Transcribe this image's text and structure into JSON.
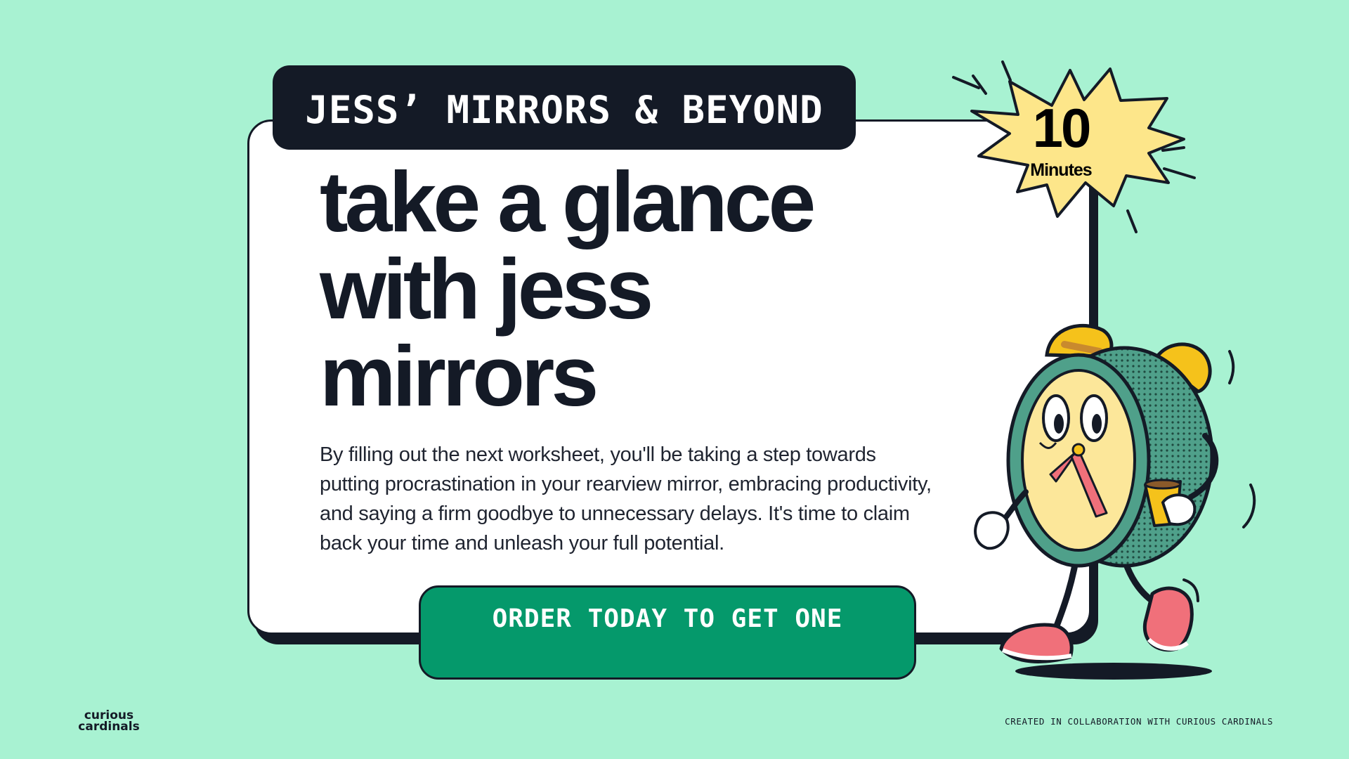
{
  "header": {
    "brand_title": "JESS’ MIRRORS & BEYOND"
  },
  "main": {
    "headline": "take a glance with jess mirrors",
    "body": "By filling out the next worksheet, you'll be taking a step towards putting procrastination in your rearview mirror, embracing productivity, and saying a firm goodbye to unnecessary delays. It's time to claim back your time and unleash your full potential.",
    "cta_label": "ORDER TODAY TO GET ONE"
  },
  "badge": {
    "number": "10",
    "label": "Minutes"
  },
  "footer": {
    "logo_line1": "curious",
    "logo_line2": "cardinals",
    "credit": "CREATED IN COLLABORATION WITH CURIOUS CARDINALS"
  },
  "colors": {
    "background": "#a8f2d2",
    "dark": "#141a26",
    "card": "#ffffff",
    "cta": "#05996b",
    "badge": "#fde68a",
    "clock_body": "#4fa08a",
    "clock_face": "#fce79a",
    "bells": "#f5c21b",
    "shoes": "#f0707a"
  },
  "icons": {
    "badge": "starburst-icon",
    "mascot": "alarm-clock-mascot-icon"
  }
}
